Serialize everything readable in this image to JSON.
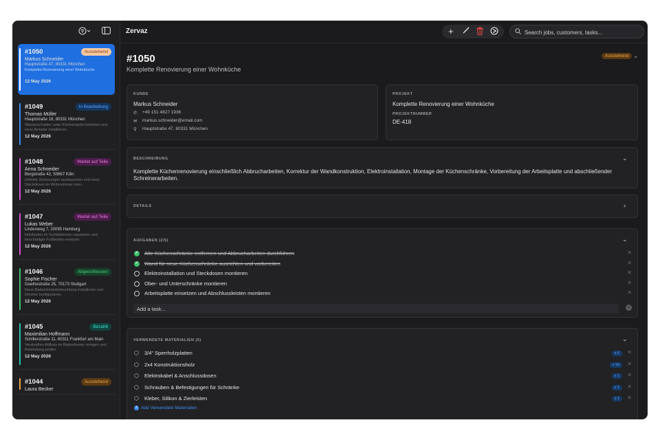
{
  "app": {
    "title": "Zervaz"
  },
  "search": {
    "placeholder": "Search jobs, customers, tasks..."
  },
  "icons": {
    "filter": "filter-icon",
    "sidebar": "sidebar-toggle-icon",
    "add": "plus-icon",
    "edit": "pencil-icon",
    "delete": "trash-icon",
    "status": "settings-icon",
    "search": "search-icon"
  },
  "jobs": [
    {
      "number": "#1050",
      "status": "Ausstehend",
      "customer": "Markus Schneider",
      "address": "Hauptstraße 47, 80331 München",
      "description": "Komplette Renovierung einer Wohnküche",
      "date": "12 May 2026",
      "accent": "#f0a84a",
      "badge_bg": "#5a3a14",
      "badge_fg": "#f0a84a"
    },
    {
      "number": "#1049",
      "status": "In Bearbeitung",
      "customer": "Thomas Müller",
      "address": "Hauptstraße 18, 80331 München",
      "description": "Wasserschaden unter Küchenspüle beheben und neue Armatur installieren.",
      "date": "12 May 2026",
      "accent": "#3e8df5",
      "badge_bg": "#153560",
      "badge_fg": "#5aa6ff"
    },
    {
      "number": "#1048",
      "status": "Wartet auf Teile",
      "customer": "Anna Schneider",
      "address": "Bergstraße 42, 50667 Köln",
      "description": "Defekte Sicherungen austauschen und neue Steckdosen im Wohnzimmer mon...",
      "date": "12 May 2026",
      "accent": "#d94fd0",
      "badge_bg": "#4e1c4c",
      "badge_fg": "#e67ee0"
    },
    {
      "number": "#1047",
      "status": "Wartet auf Teile",
      "customer": "Lukas Weber",
      "address": "Lindenweg 7, 20095 Hamburg",
      "description": "Holzboden im Schlafzimmer reparieren und beschädigte Fußleisten ersetzen.",
      "date": "12 May 2026",
      "accent": "#d94fd0",
      "badge_bg": "#4e1c4c",
      "badge_fg": "#e67ee0"
    },
    {
      "number": "#1046",
      "status": "Abgeschlossen",
      "customer": "Sophie Fischer",
      "address": "Goethestraße 25, 70173 Stuttgart",
      "description": "Neue Badezimmerbeleuchtung installieren und Dimmer konfigurieren.",
      "date": "12 May 2026",
      "accent": "#3fbf6a",
      "badge_bg": "#17422a",
      "badge_fg": "#4fd47c"
    },
    {
      "number": "#1045",
      "status": "Bezahlt",
      "customer": "Maximilian Hoffmann",
      "address": "Schillerstraße 11, 60311 Frankfurt am Main",
      "description": "Verstopften Abfluss im Badezimmer reinigen und Rohrleitung prüfen.",
      "date": "12 May 2026",
      "accent": "#23c4b0",
      "badge_bg": "#114440",
      "badge_fg": "#3fe0c8"
    },
    {
      "number": "#1044",
      "status": "Ausstehend",
      "customer": "Laura Becker",
      "address": "",
      "description": "",
      "date": "",
      "accent": "#f0a84a",
      "badge_bg": "#5a3a14",
      "badge_fg": "#f0a84a"
    }
  ],
  "detail": {
    "number": "#1050",
    "subtitle": "Komplette Renovierung einer Wohnküche",
    "status": "Ausstehend",
    "customer": {
      "label": "KUNDE",
      "name": "Markus Schneider",
      "phone": "+49 151 4827 1936",
      "email": "markus.schneider@email.com",
      "address": "Hauptstraße 47, 80331 München"
    },
    "project": {
      "label": "PROJEKT",
      "name": "Komplette Renovierung einer Wohnküche",
      "number_label": "PROJEKTNUMMER",
      "number": "DE-418"
    },
    "description": {
      "label": "BESCHREIBUNG",
      "text": "Komplette Küchenrenovierung einschließlich Abbrucharbeiten, Korrektur der Wandkonstruktion, Elektroinstallation, Montage der Küchenschränke, Vorbereitung der Arbeitsplatte und abschließender Schreinerarbeiten."
    },
    "details": {
      "label": "DETAILS"
    },
    "tasks": {
      "label": "AUFGABEN (2/5)",
      "items": [
        {
          "text": "Alte Küchenschränke entfernen und Abbrucharbeiten durchführen",
          "done": true
        },
        {
          "text": "Wand für neue Küchenschränke ausrichten und vorbereiten",
          "done": true
        },
        {
          "text": "Elektroinstallation und Steckdosen montieren",
          "done": false
        },
        {
          "text": "Ober- und Unterschränke montieren",
          "done": false
        },
        {
          "text": "Arbeitsplatte einsetzen und Abschlussleisten montieren",
          "done": false
        }
      ],
      "add_placeholder": "Add a task..."
    },
    "materials": {
      "label": "VERWENDETE MATERIALIEN (5)",
      "items": [
        {
          "name": "3/4\" Sperrholzplatten",
          "qty": "x 6"
        },
        {
          "name": "2x4 Konstruktionsholz",
          "qty": "x 18"
        },
        {
          "name": "Elektrokabel & Anschlussdosen",
          "qty": "x 1"
        },
        {
          "name": "Schrauben & Befestigungen für Schränke",
          "qty": "x 1"
        },
        {
          "name": "Kleber, Silikon & Zierleisten",
          "qty": "x 1"
        }
      ],
      "add_label": "Add Verwendete Materialien"
    }
  }
}
